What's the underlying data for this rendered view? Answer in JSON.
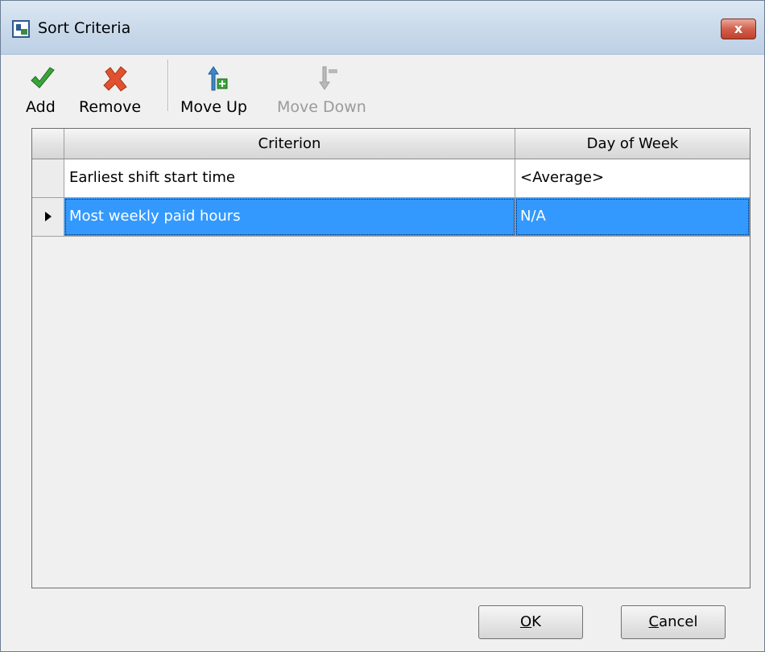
{
  "window": {
    "title": "Sort Criteria",
    "close_label": "x"
  },
  "toolbar": {
    "add": {
      "label": "Add",
      "icon": "checkmark-icon",
      "color": "#3aa33a"
    },
    "remove": {
      "label": "Remove",
      "icon": "x-icon",
      "color": "#e0522f"
    },
    "move_up": {
      "label": "Move Up",
      "icon": "arrow-up-icon",
      "color": "#3d86c7"
    },
    "move_down": {
      "label": "Move Down",
      "icon": "arrow-down-icon",
      "disabled": true
    }
  },
  "grid": {
    "columns": [
      "Criterion",
      "Day of Week"
    ],
    "rows": [
      {
        "criterion": "Earliest shift start time",
        "day": "<Average>",
        "selected": false
      },
      {
        "criterion": "Most weekly paid hours",
        "day": "N/A",
        "selected": true
      }
    ],
    "selection_color": "#3399ff"
  },
  "buttons": {
    "ok": {
      "accel": "O",
      "rest": "K"
    },
    "cancel": {
      "accel": "C",
      "rest": "ancel"
    }
  }
}
